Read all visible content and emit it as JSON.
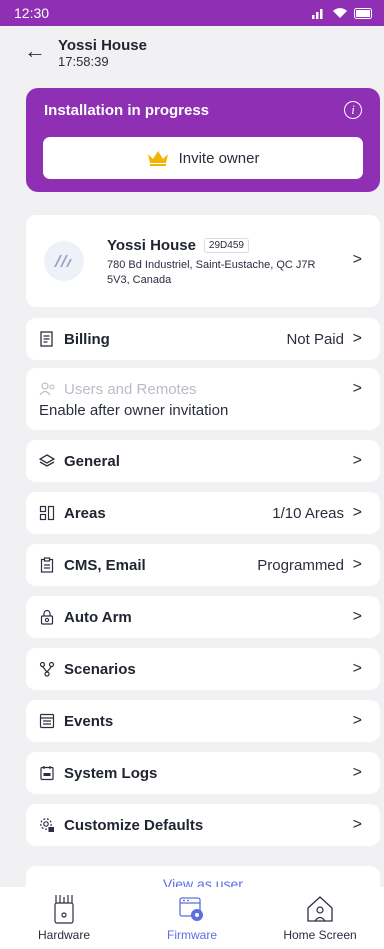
{
  "status": {
    "time": "12:30"
  },
  "header": {
    "title": "Yossi House",
    "subtitle": "17:58:39"
  },
  "banner": {
    "title": "Installation in progress",
    "invite_label": "Invite owner"
  },
  "site": {
    "name": "Yossi House",
    "code": "29D459",
    "address": "780 Bd Industriel, Saint-Eustache, QC J7R 5V3, Canada"
  },
  "menu": {
    "billing": {
      "label": "Billing",
      "value": "Not Paid"
    },
    "users": {
      "label": "Users and Remotes",
      "sub": "Enable after owner invitation"
    },
    "general": {
      "label": "General"
    },
    "areas": {
      "label": "Areas",
      "value": "1/10 Areas"
    },
    "cms": {
      "label": "CMS, Email",
      "value": "Programmed"
    },
    "autoarm": {
      "label": "Auto Arm"
    },
    "scenarios": {
      "label": "Scenarios"
    },
    "events": {
      "label": "Events"
    },
    "logs": {
      "label": "System Logs"
    },
    "defaults": {
      "label": "Customize Defaults"
    }
  },
  "view_as_user": "View as user",
  "nav": {
    "hardware": "Hardware",
    "firmware": "Firmware",
    "home": "Home Screen"
  },
  "colors": {
    "brand": "#8e2fb4",
    "accent": "#5b6fe0",
    "background": "#f1f1f4"
  }
}
